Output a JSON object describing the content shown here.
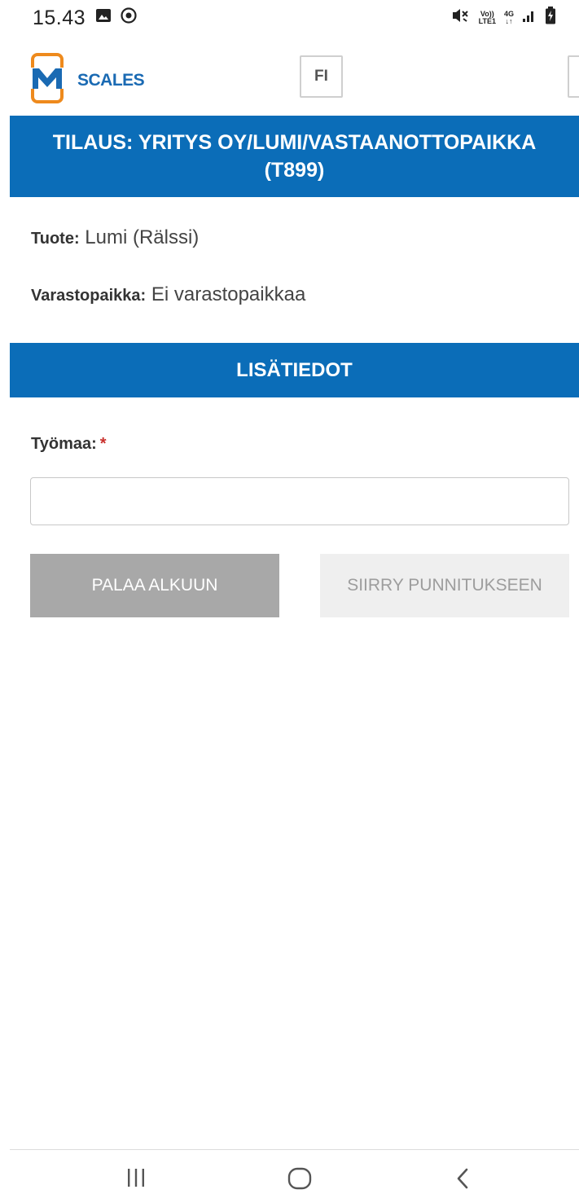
{
  "status_bar": {
    "time": "15.43",
    "left_icons": [
      "image-icon",
      "sync-icon"
    ],
    "right_icons": [
      "mute-icon",
      "volte-icon",
      "4g-icon",
      "signal-icon",
      "battery-icon"
    ],
    "volte_line1": "Vo))",
    "volte_line2": "LTE1",
    "network_label": "4G"
  },
  "header": {
    "logo_letter": "M",
    "logo_text": "SCALES",
    "language_label": "FI",
    "brand_color": "#1a6ab3",
    "accent_color": "#ee8a1d"
  },
  "order": {
    "title": "TILAUS: YRITYS OY/LUMI/VASTAANOTTOPAIKKA (T899)"
  },
  "details": {
    "product_label": "Tuote:",
    "product_value": "Lumi (Rälssi)",
    "storage_label": "Varastopaikka:",
    "storage_value": "Ei varastopaikkaa"
  },
  "extra_section": {
    "title": "LISÄTIEDOT",
    "worksite_label": "Työmaa:",
    "required_mark": "*",
    "worksite_value": "",
    "worksite_placeholder": ""
  },
  "actions": {
    "back_label": "PALAA ALKUUN",
    "next_label": "SIIRRY PUNNITUKSEEN"
  },
  "nav_bar": {
    "icons": [
      "recent-apps-icon",
      "home-icon",
      "back-icon"
    ]
  },
  "colors": {
    "primary": "#0b6db8",
    "button_disabled": "#efefef",
    "button_secondary": "#a8a8a8",
    "required": "#c9302c"
  }
}
